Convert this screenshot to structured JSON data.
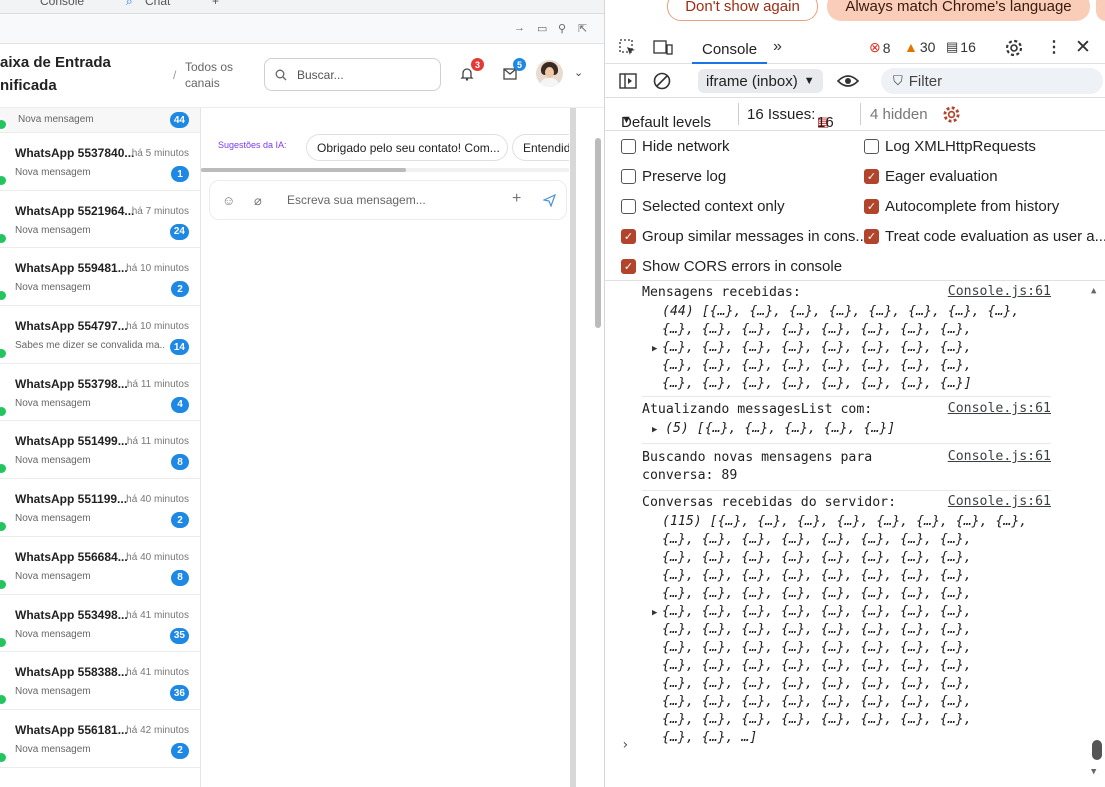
{
  "browser": {
    "tab_console": "Console",
    "tab_chat": "Chat",
    "tab_add": "+"
  },
  "app": {
    "title_line1": "aixa de Entrada",
    "title_line2": "nificada",
    "crumb_sep": "/",
    "crumb_line1": "Todos os",
    "crumb_line2": "canais",
    "search_placeholder": "Buscar...",
    "notif_count": "3",
    "mail_count": "5",
    "first_conv_sub": "Nova mensagem",
    "first_conv_count": "44",
    "conversations": [
      {
        "name": "WhatsApp 5537840...",
        "time": "há 5 minutos",
        "sub": "Nova mensagem",
        "count": "1"
      },
      {
        "name": "WhatsApp 5521964...",
        "time": "há 7 minutos",
        "sub": "Nova mensagem",
        "count": "24"
      },
      {
        "name": "WhatsApp 559481...",
        "time": "há 10 minutos",
        "sub": "Nova mensagem",
        "count": "2"
      },
      {
        "name": "WhatsApp 554797...",
        "time": "há 10 minutos",
        "sub": "Sabes me dizer se convalida ma...",
        "count": "14"
      },
      {
        "name": "WhatsApp 553798...",
        "time": "há 11 minutos",
        "sub": "Nova mensagem",
        "count": "4"
      },
      {
        "name": "WhatsApp 551499...",
        "time": "há 11 minutos",
        "sub": "Nova mensagem",
        "count": "8"
      },
      {
        "name": "WhatsApp 551199...",
        "time": "há 40 minutos",
        "sub": "Nova mensagem",
        "count": "2"
      },
      {
        "name": "WhatsApp 556684...",
        "time": "há 40 minutos",
        "sub": "Nova mensagem",
        "count": "8"
      },
      {
        "name": "WhatsApp 553498...",
        "time": "há 41 minutos",
        "sub": "Nova mensagem",
        "count": "35"
      },
      {
        "name": "WhatsApp 558388...",
        "time": "há 41 minutos",
        "sub": "Nova mensagem",
        "count": "36"
      },
      {
        "name": "WhatsApp 556181...",
        "time": "há 42 minutos",
        "sub": "Nova mensagem",
        "count": "2"
      }
    ],
    "suggestions_label": "Sugestões da IA:",
    "suggestion_1": "Obrigado pelo seu contato! Com...",
    "suggestion_2": "Entendid",
    "composer_placeholder": "Escreva sua mensagem..."
  },
  "devtools": {
    "dont_show": "Don't show again",
    "always_match": "Always match Chrome's language",
    "console_tab": "Console",
    "errors": "8",
    "warnings": "30",
    "messages": "16",
    "context": "iframe (inbox)",
    "filter_placeholder": "Filter",
    "levels": "Default levels",
    "issues_label": "16 Issues:",
    "issues_count": "16",
    "hidden": "4 hidden",
    "options": [
      {
        "label": "Hide network",
        "checked": false
      },
      {
        "label": "Log XMLHttpRequests",
        "checked": false
      },
      {
        "label": "Preserve log",
        "checked": false
      },
      {
        "label": "Eager evaluation",
        "checked": true
      },
      {
        "label": "Selected context only",
        "checked": false
      },
      {
        "label": "Autocomplete from history",
        "checked": true
      },
      {
        "label": "Group similar messages in cons...",
        "checked": true
      },
      {
        "label": "Treat code evaluation as user a...",
        "checked": true
      },
      {
        "label": "Show CORS errors in console",
        "checked": true
      }
    ],
    "log": {
      "m1_label": "Mensagens recebidas:",
      "m1_src": "Console.js:61",
      "m1_lines": [
        "(44) [{…}, {…}, {…}, {…}, {…}, {…}, {…}, {…},",
        "{…}, {…}, {…}, {…}, {…}, {…}, {…}, {…},",
        "{…}, {…}, {…}, {…}, {…}, {…}, {…}, {…},",
        "{…}, {…}, {…}, {…}, {…}, {…}, {…}, {…},",
        "{…}, {…}, {…}, {…}, {…}, {…}, {…}, {…}]"
      ],
      "m2_label": "Atualizando messagesList com:",
      "m2_src": "Console.js:61",
      "m2_line": "(5) [{…}, {…}, {…}, {…}, {…}]",
      "m3_line1": "Buscando novas mensagens para",
      "m3_line2": "conversa: 89",
      "m3_src": "Console.js:61",
      "m4_label": "Conversas recebidas do servidor:",
      "m4_src": "Console.js:61",
      "m4_lines": [
        "(115) [{…}, {…}, {…}, {…}, {…}, {…}, {…}, {…},",
        "{…}, {…}, {…}, {…}, {…}, {…}, {…}, {…},",
        "{…}, {…}, {…}, {…}, {…}, {…}, {…}, {…},",
        "{…}, {…}, {…}, {…}, {…}, {…}, {…}, {…},",
        "{…}, {…}, {…}, {…}, {…}, {…}, {…}, {…},",
        "{…}, {…}, {…}, {…}, {…}, {…}, {…}, {…},",
        "{…}, {…}, {…}, {…}, {…}, {…}, {…}, {…},",
        "{…}, {…}, {…}, {…}, {…}, {…}, {…}, {…},",
        "{…}, {…}, {…}, {…}, {…}, {…}, {…}, {…},",
        "{…}, {…}, {…}, {…}, {…}, {…}, {…}, {…},",
        "{…}, {…}, {…}, {…}, {…}, {…}, {…}, {…},",
        "{…}, {…}, {…}, {…}, {…}, {…}, {…}, {…},",
        "{…}, {…}, …]"
      ],
      "prompt": "›"
    }
  },
  "colors": {
    "accent_blue": "#1e88e5",
    "online_green": "#22c55e",
    "devtools_blue": "#1a73e8",
    "checkbox_on": "#b3442c",
    "error_red": "#d93025",
    "warning_orange": "#e37400"
  }
}
